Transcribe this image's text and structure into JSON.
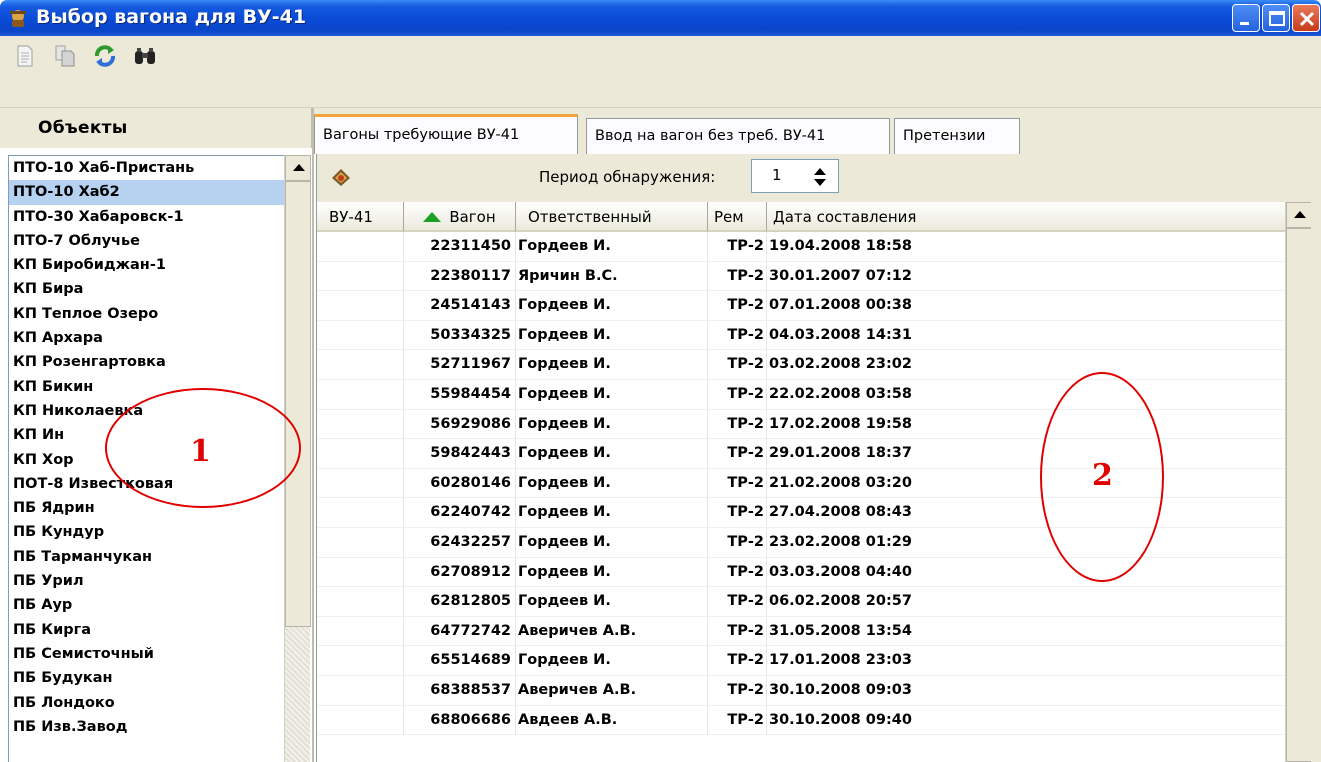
{
  "window": {
    "title": "Выбор вагона для ВУ-41",
    "icon": "app-bust-icon"
  },
  "toolbar": {
    "buttons": [
      {
        "name": "document-icon"
      },
      {
        "name": "copy-icon"
      },
      {
        "name": "refresh-icon"
      },
      {
        "name": "binoculars-icon"
      }
    ]
  },
  "left_panel": {
    "header": "Объекты",
    "items": [
      "ПТО-10 Хаб-Пристань",
      "ПТО-10 Хаб2",
      "ПТО-30 Хабаровск-1",
      "ПТО-7 Облучье",
      "КП Биробиджан-1",
      "КП Бира",
      "КП Теплое Озеро",
      "КП Архара",
      "КП Розенгартовка",
      "КП Бикин",
      "КП Николаевка",
      "КП Ин",
      "КП Хор",
      "ПОТ-8 Известковая",
      "ПБ Ядрин",
      "ПБ Кундур",
      "ПБ Тарманчукан",
      "ПБ Урил",
      "ПБ Аур",
      "ПБ Кирга",
      "ПБ Семисточный",
      "ПБ Будукан",
      "ПБ Лондоко",
      "ПБ Изв.Завод"
    ],
    "selected_index": 1
  },
  "tabs": [
    {
      "label": "Вагоны требующие ВУ-41",
      "active": true
    },
    {
      "label": "Ввод на вагон без треб. ВУ-41",
      "active": false
    },
    {
      "label": "Претензии",
      "active": false
    }
  ],
  "filter": {
    "period_label": "Период обнаружения:",
    "period_value": "1"
  },
  "grid": {
    "columns": [
      "ВУ-41",
      "Вагон",
      "Ответственный",
      "Рем",
      "Дата составления"
    ],
    "sort_column": "Вагон",
    "rows": [
      {
        "vu": "",
        "vagon": "22311450",
        "otv": "Гордеев И.",
        "rem": "ТР-2",
        "date": "19.04.2008 18:58"
      },
      {
        "vu": "",
        "vagon": "22380117",
        "otv": "Яричин В.С.",
        "rem": "ТР-2",
        "date": "30.01.2007 07:12"
      },
      {
        "vu": "",
        "vagon": "24514143",
        "otv": "Гордеев И.",
        "rem": "ТР-2",
        "date": "07.01.2008 00:38"
      },
      {
        "vu": "",
        "vagon": "50334325",
        "otv": "Гордеев И.",
        "rem": "ТР-2",
        "date": "04.03.2008 14:31"
      },
      {
        "vu": "",
        "vagon": "52711967",
        "otv": "Гордеев И.",
        "rem": "ТР-2",
        "date": "03.02.2008 23:02"
      },
      {
        "vu": "",
        "vagon": "55984454",
        "otv": "Гордеев И.",
        "rem": "ТР-2",
        "date": "22.02.2008 03:58"
      },
      {
        "vu": "",
        "vagon": "56929086",
        "otv": "Гордеев И.",
        "rem": "ТР-2",
        "date": "17.02.2008 19:58"
      },
      {
        "vu": "",
        "vagon": "59842443",
        "otv": "Гордеев И.",
        "rem": "ТР-2",
        "date": "29.01.2008 18:37"
      },
      {
        "vu": "",
        "vagon": "60280146",
        "otv": "Гордеев И.",
        "rem": "ТР-2",
        "date": "21.02.2008 03:20"
      },
      {
        "vu": "",
        "vagon": "62240742",
        "otv": "Гордеев И.",
        "rem": "ТР-2",
        "date": "27.04.2008 08:43"
      },
      {
        "vu": "",
        "vagon": "62432257",
        "otv": "Гордеев И.",
        "rem": "ТР-2",
        "date": "23.02.2008 01:29"
      },
      {
        "vu": "",
        "vagon": "62708912",
        "otv": "Гордеев И.",
        "rem": "ТР-2",
        "date": "03.03.2008 04:40"
      },
      {
        "vu": "",
        "vagon": "62812805",
        "otv": "Гордеев И.",
        "rem": "ТР-2",
        "date": "06.02.2008 20:57"
      },
      {
        "vu": "",
        "vagon": "64772742",
        "otv": "Аверичев А.В.",
        "rem": "ТР-2",
        "date": "31.05.2008 13:54"
      },
      {
        "vu": "",
        "vagon": "65514689",
        "otv": "Гордеев И.",
        "rem": "ТР-2",
        "date": "17.01.2008 23:03"
      },
      {
        "vu": "",
        "vagon": "68388537",
        "otv": "Аверичев А.В.",
        "rem": "ТР-2",
        "date": "30.10.2008 09:03"
      },
      {
        "vu": "",
        "vagon": "68806686",
        "otv": "Авдеев А.В.",
        "rem": "ТР-2",
        "date": "30.10.2008 09:40"
      }
    ]
  },
  "annotations": {
    "label_1": "1",
    "label_2": "2",
    "color": "#e00000"
  }
}
